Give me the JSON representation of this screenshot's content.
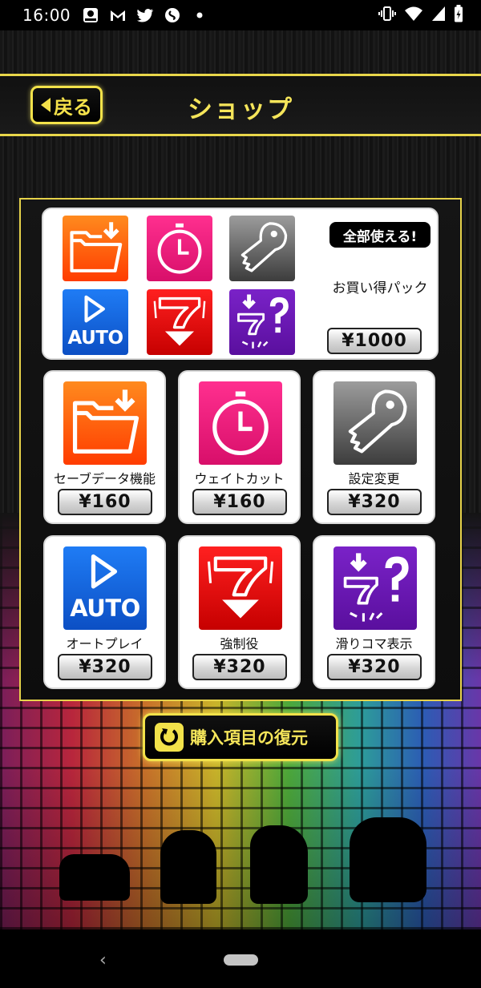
{
  "status_bar": {
    "time": "16:00",
    "icons": [
      "netchu-app-icon",
      "gmail-icon",
      "twitter-icon",
      "shazam-icon",
      "dot-icon"
    ],
    "right_icons": [
      "vibrate-icon",
      "wifi-icon",
      "signal-icon",
      "battery-charging-icon"
    ]
  },
  "header": {
    "back_label": "戻る",
    "title": "ショップ"
  },
  "bundle": {
    "badge": "全部使える!",
    "name": "お買い得パック",
    "price": "¥1000",
    "icons": [
      "save-folder-icon",
      "timer-icon",
      "key-icon",
      "auto-play-icon",
      "force-seven-icon",
      "slip-koma-icon"
    ]
  },
  "items": [
    {
      "label": "セーブデータ機能",
      "price": "¥160",
      "icon": "save-folder-icon"
    },
    {
      "label": "ウェイトカット",
      "price": "¥160",
      "icon": "timer-icon"
    },
    {
      "label": "設定変更",
      "price": "¥320",
      "icon": "key-icon"
    },
    {
      "label": "オートプレイ",
      "price": "¥320",
      "icon": "auto-play-icon"
    },
    {
      "label": "強制役",
      "price": "¥320",
      "icon": "force-seven-icon"
    },
    {
      "label": "滑りコマ表示",
      "price": "¥320",
      "icon": "slip-koma-icon"
    }
  ],
  "icon_text": {
    "auto": "AUTO"
  },
  "restore": {
    "label": "購入項目の復元"
  },
  "nav": {
    "back_glyph": "‹"
  },
  "colors": {
    "accent_yellow": "#f2e24a",
    "orange": "#ff6a00",
    "pink": "#e8197a",
    "gray": "#8a8a8a",
    "blue": "#1565d8",
    "red": "#e01010",
    "purple": "#6a1bb0"
  }
}
